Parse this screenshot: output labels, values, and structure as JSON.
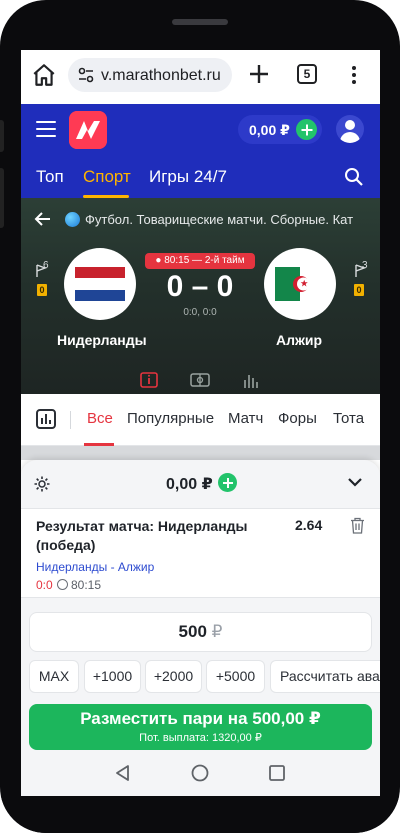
{
  "browser": {
    "url": "v.marathonbet.ru",
    "tab_count": "5"
  },
  "header": {
    "balance": "0,00 ₽"
  },
  "nav": {
    "items": [
      "Топ",
      "Спорт",
      "Игры 24/7"
    ],
    "active": "Спорт"
  },
  "match": {
    "breadcrumb": "Футбол. Товарищеские матчи. Сборные. Кат",
    "live_status": "● 80:15 — 2-й тайм",
    "score": "0 – 0",
    "subscore": "0:0, 0:0",
    "home_team": "Нидерланды",
    "away_team": "Алжир",
    "home_stat": "6",
    "away_stat": "3",
    "home_cards": "0",
    "away_cards": "0",
    "colors": {
      "live": "#e5343f",
      "card": "#f2b100"
    }
  },
  "market_tabs": [
    "Все",
    "Популярные",
    "Матч",
    "Форы",
    "Тота"
  ],
  "coupon": {
    "amount": "0,00 ₽",
    "bet_title": "Результат матча: Нидерланды (победа)",
    "odds": "2.64",
    "event": "Нидерланды - Алжир",
    "event_score": "0:0",
    "event_time": "80:15",
    "stake_value": "500",
    "stake_currency": "₽",
    "chips": [
      "MAX",
      "+1000",
      "+2000",
      "+5000",
      "Рассчитать ава"
    ],
    "place_label": "Разместить пари на 500,00 ₽",
    "payout_label": "Пот. выплата: 1320,00 ₽",
    "accent": "#1cb65c"
  }
}
